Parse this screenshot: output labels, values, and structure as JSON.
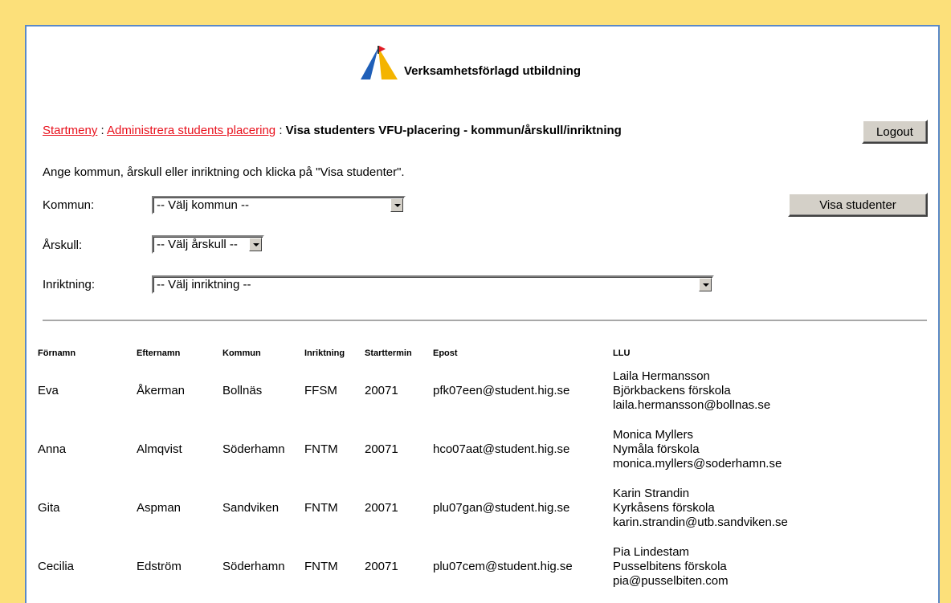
{
  "header": {
    "title": "Verksamhetsförlagd utbildning"
  },
  "breadcrumb": {
    "link1": "Startmeny",
    "sep1": " : ",
    "link2": "Administrera students placering",
    "sep2": " : ",
    "current": "Visa studenters VFU-placering - kommun/årskull/inriktning"
  },
  "logout_label": "Logout",
  "instructions": "Ange kommun, årskull eller inriktning och klicka på \"Visa studenter\".",
  "filters": {
    "kommun": {
      "label": "Kommun:",
      "value": "-- Välj kommun --"
    },
    "arskull": {
      "label": "Årskull:",
      "value": "-- Välj årskull --"
    },
    "inriktning": {
      "label": "Inriktning:",
      "value": "-- Välj inriktning --"
    }
  },
  "visa_label": "Visa studenter",
  "table": {
    "headers": [
      "Förnamn",
      "Efternamn",
      "Kommun",
      "Inriktning",
      "Starttermin",
      "Epost",
      "LLU"
    ],
    "rows": [
      {
        "fornamn": "Eva",
        "efternamn": "Åkerman",
        "kommun": "Bollnäs",
        "inriktning": "FFSM",
        "starttermin": "20071",
        "epost": "pfk07een@student.hig.se",
        "llu": [
          "Laila Hermansson",
          "Björkbackens förskola",
          "laila.hermansson@bollnas.se"
        ]
      },
      {
        "fornamn": "Anna",
        "efternamn": "Almqvist",
        "kommun": "Söderhamn",
        "inriktning": "FNTM",
        "starttermin": "20071",
        "epost": "hco07aat@student.hig.se",
        "llu": [
          "Monica Myllers",
          "Nymåla förskola",
          "monica.myllers@soderhamn.se"
        ]
      },
      {
        "fornamn": "Gita",
        "efternamn": "Aspman",
        "kommun": "Sandviken",
        "inriktning": "FNTM",
        "starttermin": "20071",
        "epost": "plu07gan@student.hig.se",
        "llu": [
          "Karin Strandin",
          "Kyrkåsens förskola",
          "karin.strandin@utb.sandviken.se"
        ]
      },
      {
        "fornamn": "Cecilia",
        "efternamn": "Edström",
        "kommun": "Söderhamn",
        "inriktning": "FNTM",
        "starttermin": "20071",
        "epost": "plu07cem@student.hig.se",
        "llu": [
          "Pia Lindestam",
          "Pusselbitens förskola",
          "pia@pusselbiten.com"
        ]
      }
    ]
  }
}
